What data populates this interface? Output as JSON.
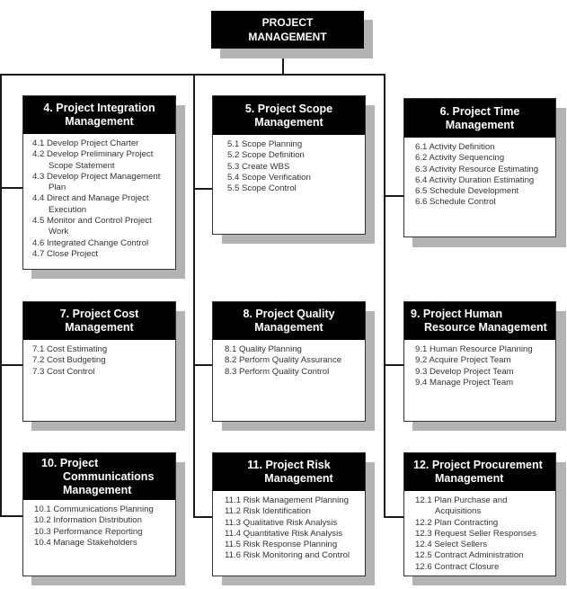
{
  "root": {
    "line1": "PROJECT",
    "line2": "MANAGEMENT"
  },
  "areas": [
    {
      "number": "4",
      "title_line1": "4. Project Integration",
      "title_line2": "Management",
      "items": [
        "4.1 Develop Project Charter",
        "4.2 Develop Preliminary Project Scope Statement",
        "4.3 Develop Project Management Plan",
        "4.4 Direct and Manage Project Execution",
        "4.5 Monitor and Control Project Work",
        "4.6 Integrated Change Control",
        "4.7 Close Project"
      ]
    },
    {
      "number": "5",
      "title_line1": "5. Project Scope",
      "title_line2": "Management",
      "items": [
        "5.1 Scope Planning",
        "5.2 Scope Definition",
        "5.3 Create WBS",
        "5.4 Scope Verification",
        "5.5 Scope Control"
      ]
    },
    {
      "number": "6",
      "title_line1": "6. Project Time",
      "title_line2": "Management",
      "items": [
        "6.1 Activity Definition",
        "6.2 Activity Sequencing",
        "6.3 Activity Resource Estimating",
        "6.4 Activity Duration Estimating",
        "6.5 Schedule Development",
        "6.6 Schedule Control"
      ]
    },
    {
      "number": "7",
      "title_line1": "7. Project Cost",
      "title_line2": "Management",
      "items": [
        "7.1 Cost Estimating",
        "7.2 Cost Budgeting",
        "7.3 Cost Control"
      ]
    },
    {
      "number": "8",
      "title_line1": "8. Project Quality",
      "title_line2": "Management",
      "items": [
        "8.1 Quality Planning",
        "8.2 Perform Quality Assurance",
        "8.3 Perform Quality Control"
      ]
    },
    {
      "number": "9",
      "title_line1": "9. Project Human",
      "title_line2": "Resource Management",
      "items": [
        "9.1 Human Resource Planning",
        "9.2 Acquire Project Team",
        "9.3 Develop Project Team",
        "9.4 Manage Project Team"
      ]
    },
    {
      "number": "10",
      "title_line1": "10. Project",
      "title_line2": "Communications",
      "title_line3": "Management",
      "items": [
        "10.1 Communications Planning",
        "10.2 Information Distribution",
        "10.3 Performance Reporting",
        "10.4 Manage Stakeholders"
      ]
    },
    {
      "number": "11",
      "title_line1": "11. Project Risk",
      "title_line2": "Management",
      "items": [
        "11.1 Risk Management Planning",
        "11.2 Risk Identification",
        "11.3 Qualitative Risk Analysis",
        "11.4 Quantitative Risk Analysis",
        "11.5 Risk Response Planning",
        "11.6 Risk Monitoring and Control"
      ]
    },
    {
      "number": "12",
      "title_line1": "12. Project Procurement",
      "title_line2": "Management",
      "items": [
        "12.1 Plan Purchase and Acquisitions",
        "12.2 Plan Contracting",
        "12.3 Request Seller Responses",
        "12.4 Select Sellers",
        "12.5 Contract Administration",
        "12.6 Contract Closure"
      ]
    }
  ]
}
